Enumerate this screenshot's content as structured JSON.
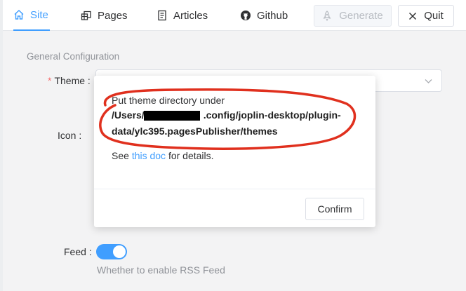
{
  "nav": {
    "tabs": [
      {
        "label": "Site",
        "icon": "home-icon"
      },
      {
        "label": "Pages",
        "icon": "pages-icon"
      },
      {
        "label": "Articles",
        "icon": "document-icon"
      },
      {
        "label": "Github",
        "icon": "github-icon"
      }
    ],
    "generate_label": "Generate",
    "quit_label": "Quit"
  },
  "form": {
    "section_title": "General Configuration",
    "theme_label": "Theme",
    "icon_label": "Icon",
    "feed_label": "Feed",
    "feed_enabled": true,
    "feed_hint": "Whether to enable RSS Feed",
    "required_mark": "*",
    "colon": ":"
  },
  "popup": {
    "intro": "Put theme directory under",
    "path_line1_prefix": "/Users/",
    "path_line1_suffix": ".config/joplin-desktop/plugin-",
    "path_line2": "data/ylc395.pagesPublisher/themes",
    "see_prefix": "See ",
    "link_text": "this doc",
    "see_suffix": " for details.",
    "confirm_label": "Confirm"
  },
  "colors": {
    "accent": "#409eff",
    "annotation": "#e0301e",
    "required": "#f56c6c"
  }
}
